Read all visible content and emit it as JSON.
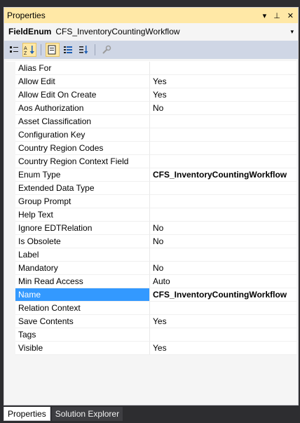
{
  "window": {
    "title": "Properties",
    "dropdown_glyph": "▾",
    "pin_glyph": "𝟜",
    "close_glyph": "✕"
  },
  "object": {
    "type": "FieldEnum",
    "name": "CFS_InventoryCountingWorkflow",
    "dropdown_glyph": "▾"
  },
  "toolbar": {
    "icons": [
      "categorized-icon",
      "alphabetical-icon",
      "property-pages-icon",
      "events-icon",
      "sort-icon",
      "settings-icon"
    ]
  },
  "properties": [
    {
      "name": "Alias For",
      "value": ""
    },
    {
      "name": "Allow Edit",
      "value": "Yes"
    },
    {
      "name": "Allow Edit On Create",
      "value": "Yes"
    },
    {
      "name": "Aos Authorization",
      "value": "No"
    },
    {
      "name": "Asset Classification",
      "value": ""
    },
    {
      "name": "Configuration Key",
      "value": ""
    },
    {
      "name": "Country Region Codes",
      "value": ""
    },
    {
      "name": "Country Region Context Field",
      "value": ""
    },
    {
      "name": "Enum Type",
      "value": "CFS_InventoryCountingWorkflow"
    },
    {
      "name": "Extended Data Type",
      "value": ""
    },
    {
      "name": "Group Prompt",
      "value": ""
    },
    {
      "name": "Help Text",
      "value": ""
    },
    {
      "name": "Ignore EDTRelation",
      "value": "No"
    },
    {
      "name": "Is Obsolete",
      "value": "No"
    },
    {
      "name": "Label",
      "value": ""
    },
    {
      "name": "Mandatory",
      "value": "No"
    },
    {
      "name": "Min Read Access",
      "value": "Auto"
    },
    {
      "name": "Name",
      "value": "CFS_InventoryCountingWorkflow"
    },
    {
      "name": "Relation Context",
      "value": ""
    },
    {
      "name": "Save Contents",
      "value": "Yes"
    },
    {
      "name": "Tags",
      "value": ""
    },
    {
      "name": "Visible",
      "value": "Yes"
    }
  ],
  "selected_property": "Name",
  "bold_values": [
    "Enum Type",
    "Name"
  ],
  "tabs": [
    {
      "label": "Properties",
      "active": true
    },
    {
      "label": "Solution Explorer",
      "active": false
    }
  ],
  "colors": {
    "selection": "#3399ff",
    "title_bar": "#ffe8a6",
    "toolbar": "#cfd6e5"
  }
}
